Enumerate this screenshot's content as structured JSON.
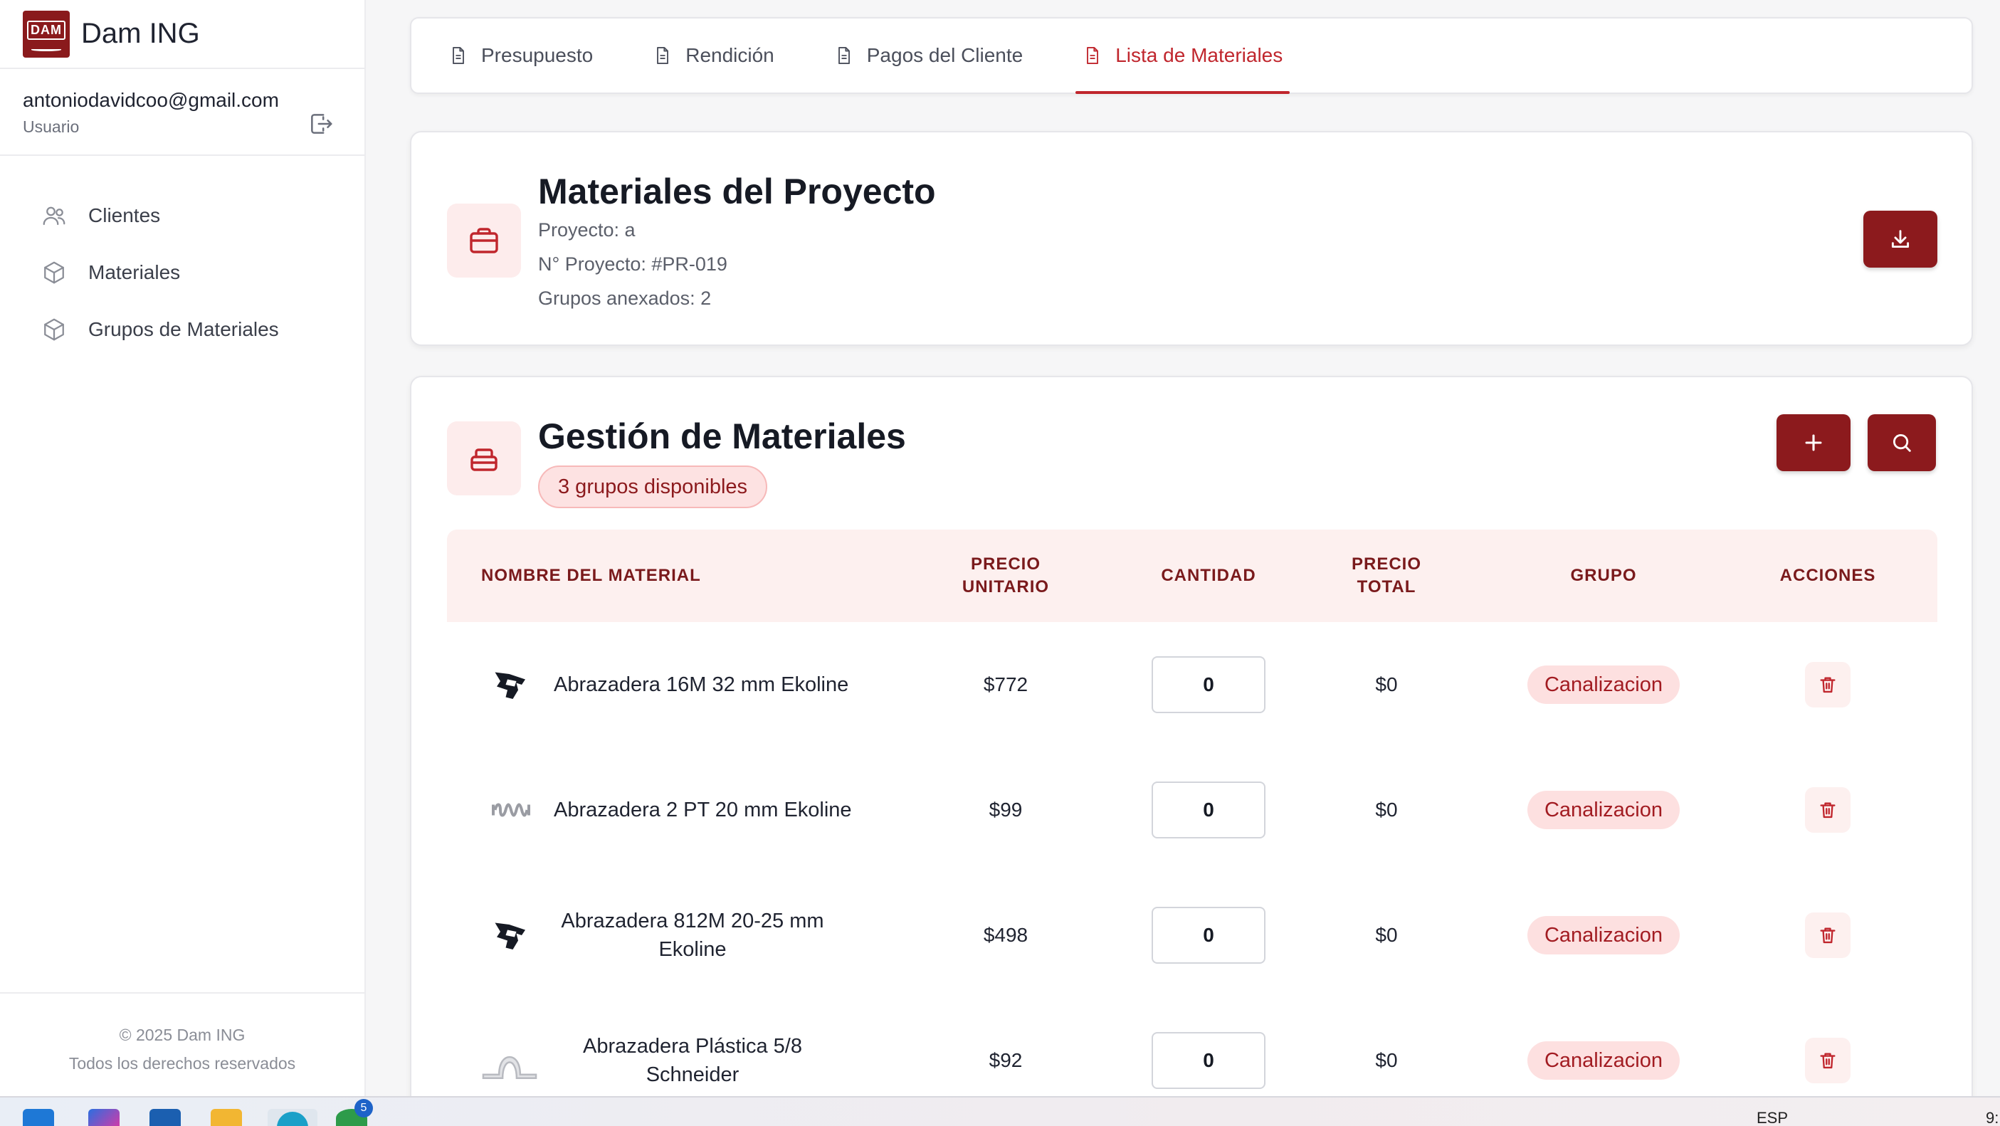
{
  "brand": {
    "name": "Dam ING",
    "logo_text": "DAM"
  },
  "user": {
    "email": "antoniodavidcoo@gmail.com",
    "role": "Usuario"
  },
  "sidebar": {
    "items": [
      {
        "label": "Clientes",
        "icon": "users-icon"
      },
      {
        "label": "Materiales",
        "icon": "box-icon"
      },
      {
        "label": "Grupos de Materiales",
        "icon": "box-icon"
      }
    ],
    "footer": {
      "copyright": "© 2025 Dam ING",
      "rights": "Todos los derechos reservados"
    }
  },
  "tabs": [
    {
      "label": "Presupuesto",
      "active": false
    },
    {
      "label": "Rendición",
      "active": false
    },
    {
      "label": "Pagos del Cliente",
      "active": false
    },
    {
      "label": "Lista de Materiales",
      "active": true
    }
  ],
  "project_card": {
    "title": "Materiales del Proyecto",
    "project": "Proyecto: a",
    "number": "N° Proyecto: #PR-019",
    "groups": "Grupos anexados: 2"
  },
  "materials_card": {
    "title": "Gestión de Materiales",
    "badge": "3 grupos disponibles",
    "columns": {
      "name": "NOMBRE DEL MATERIAL",
      "unit_price": "PRECIO UNITARIO",
      "quantity": "CANTIDAD",
      "total_price": "PRECIO TOTAL",
      "group": "GRUPO",
      "actions": "ACCIONES"
    },
    "rows": [
      {
        "name": "Abrazadera 16M 32 mm Ekoline",
        "unit_price": "$772",
        "quantity": "0",
        "total": "$0",
        "group": "Canalizacion",
        "icon": "clamp-icon"
      },
      {
        "name": "Abrazadera 2 PT 20 mm Ekoline",
        "unit_price": "$99",
        "quantity": "0",
        "total": "$0",
        "group": "Canalizacion",
        "icon": "spring-clamp-icon"
      },
      {
        "name": "Abrazadera 812M 20-25 mm Ekoline",
        "unit_price": "$498",
        "quantity": "0",
        "total": "$0",
        "group": "Canalizacion",
        "icon": "clamp-icon"
      },
      {
        "name": "Abrazadera Plástica 5/8 Schneider",
        "unit_price": "$92",
        "quantity": "0",
        "total": "$0",
        "group": "Canalizacion",
        "icon": "plastic-clamp-icon"
      }
    ]
  },
  "taskbar": {
    "language": "ESP",
    "time": "9:",
    "badge_count": "5"
  },
  "colors": {
    "accent": "#c0262d",
    "brand_dark": "#8c1a1d",
    "pill_bg": "#fde0e0"
  }
}
